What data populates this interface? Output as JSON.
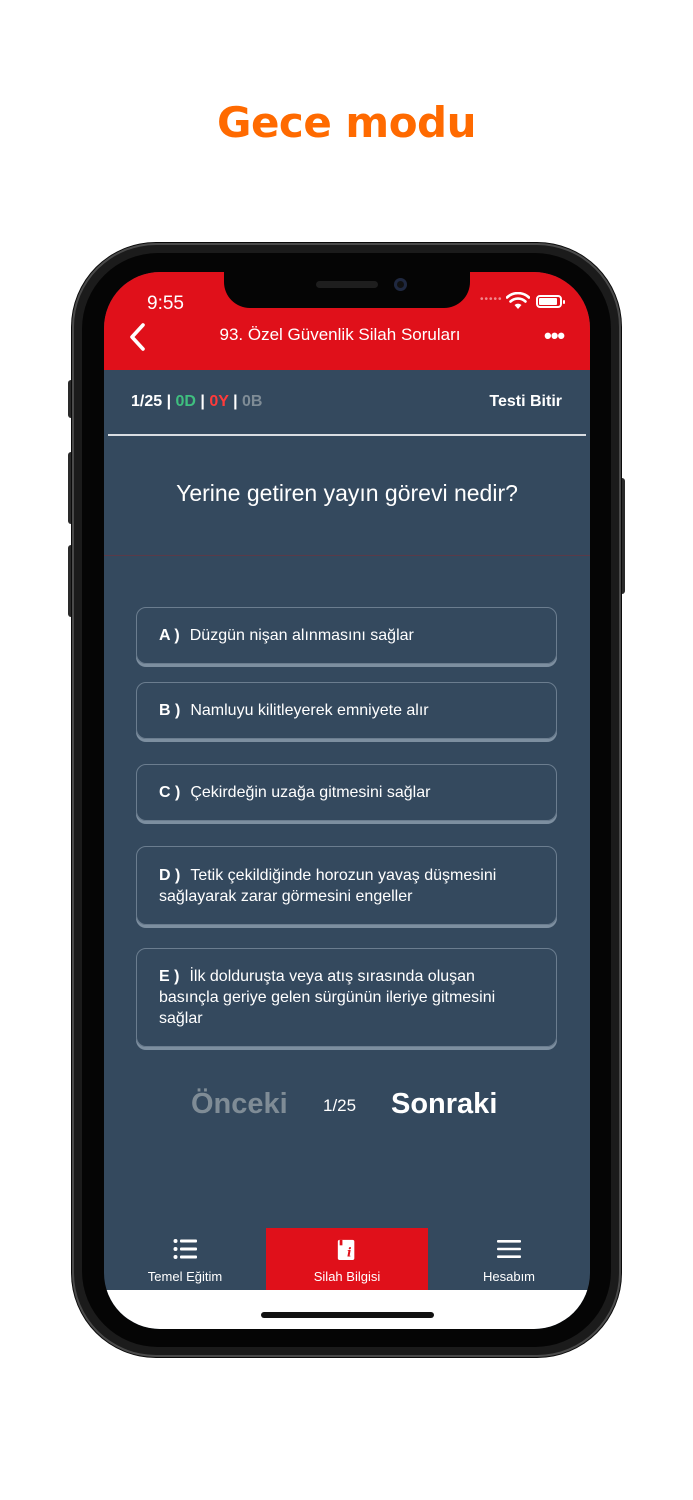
{
  "promo": {
    "title": "Gece modu"
  },
  "status_bar": {
    "time": "9:55",
    "dots": "•••••"
  },
  "nav": {
    "title": "93. Özel Güvenlik Silah Soruları"
  },
  "score": {
    "position": "1/25",
    "sep1": " | ",
    "correct": "0D",
    "sep2": " | ",
    "wrong": "0Y",
    "sep3": " | ",
    "empty": "0B"
  },
  "finish_label": "Testi Bitir",
  "question": "Yerine getiren yayın görevi nedir?",
  "options": [
    {
      "letter": "A )",
      "text": "Düzgün nişan alınmasını sağlar"
    },
    {
      "letter": "B )",
      "text": "Namluyu kilitleyerek emniyete alır"
    },
    {
      "letter": "C )",
      "text": "Çekirdeğin uzağa gitmesini sağlar"
    },
    {
      "letter": "D )",
      "text": "Tetik çekildiğinde horozun yavaş düşmesini sağlayarak zarar görmesini engeller"
    },
    {
      "letter": "E )",
      "text": "İlk dolduruşta veya atış sırasında oluşan basınçla geriye gelen sürgünün ileriye gitmesini sağlar"
    }
  ],
  "pagination": {
    "prev": "Önceki",
    "counter": "1/25",
    "next": "Sonraki"
  },
  "tabs": [
    {
      "label": "Temel Eğitim",
      "icon": "list-icon"
    },
    {
      "label": "Silah Bilgisi",
      "icon": "info-book-icon"
    },
    {
      "label": "Hesabım",
      "icon": "menu-icon"
    }
  ],
  "colors": {
    "accent": "#e0101a",
    "promo": "#ff6a00",
    "background": "#34495e",
    "correct": "#3fbf7f",
    "wrong": "#ff3a3a",
    "muted": "#7f8c96"
  }
}
